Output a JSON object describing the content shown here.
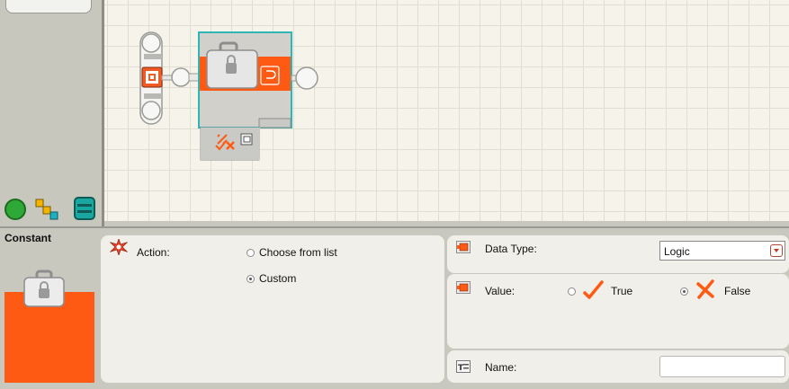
{
  "block": {
    "title": "Constant"
  },
  "action": {
    "label": "Action:",
    "options": [
      "Choose from list",
      "Custom"
    ],
    "selected": "Custom"
  },
  "data_type": {
    "label": "Data Type:",
    "value": "Logic"
  },
  "value": {
    "label": "Value:",
    "true_label": "True",
    "false_label": "False",
    "selected": "False"
  },
  "name": {
    "label": "Name:",
    "value": ""
  },
  "colors": {
    "accent": "#ff5a14",
    "selection": "#2fb5b5",
    "panel": "#c9c8bf",
    "pane": "#f0efe9"
  },
  "icons": {
    "action": "starburst-icon",
    "data_type": "plug-icon",
    "value": "plug-icon",
    "name": "name-tag-icon",
    "true": "checkmark-icon",
    "false": "cross-icon"
  }
}
